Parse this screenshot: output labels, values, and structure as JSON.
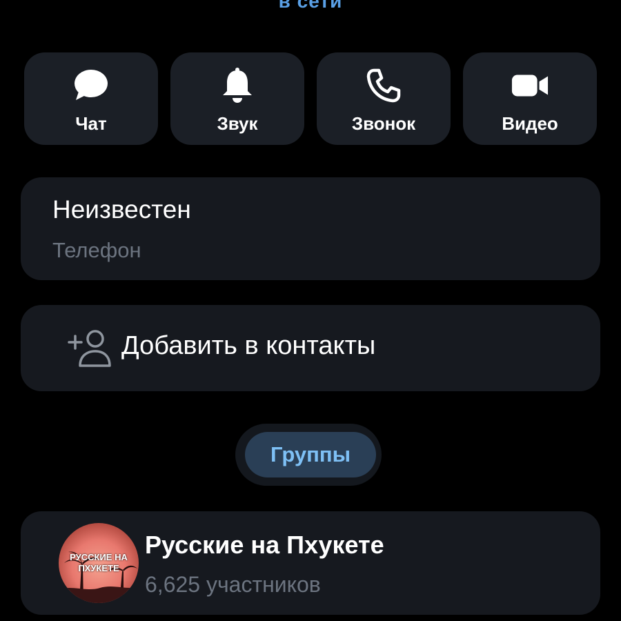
{
  "status": {
    "text": "в сети"
  },
  "actions": [
    {
      "label": "Чат",
      "icon": "chat-bubble-icon"
    },
    {
      "label": "Звук",
      "icon": "bell-icon"
    },
    {
      "label": "Звонок",
      "icon": "phone-icon"
    },
    {
      "label": "Видео",
      "icon": "video-camera-icon"
    }
  ],
  "phone": {
    "value": "Неизвестен",
    "label": "Телефон"
  },
  "add_contact": {
    "label": "Добавить в контакты",
    "icon": "add-user-icon"
  },
  "groups_tab": {
    "label": "Группы"
  },
  "group": {
    "name": "Русские на Пхукете",
    "members": "6,625 участников",
    "avatar_text_line1": "РУССКИЕ НА",
    "avatar_text_line2": "ПХУКЕТЕ"
  },
  "colors": {
    "background": "#000000",
    "card": "#16191f",
    "accent": "#7ec0f5",
    "muted_text": "#6c7480"
  }
}
